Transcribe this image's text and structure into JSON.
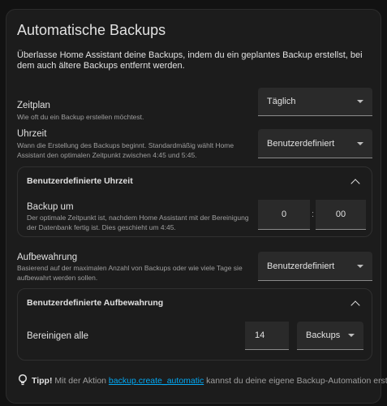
{
  "card": {
    "title": "Automatische Backups",
    "intro": "Überlasse Home Assistant deine Backups, indem du ein geplantes Backup erstellst, bei dem auch ältere Backups entfernt werden."
  },
  "schedule": {
    "title": "Zeitplan",
    "desc": "Wie oft du ein Backup erstellen möchtest.",
    "value": "Täglich",
    "icon": "chevron-down-icon"
  },
  "time": {
    "title": "Uhrzeit",
    "desc": "Wann die Erstellung des Backups beginnt. Standardmäßig wählt Home Assistant den optimalen Zeitpunkt zwischen 4:45 und 5:45.",
    "value": "Benutzerdefiniert"
  },
  "custom_time": {
    "header": "Benutzerdefinierte Uhrzeit",
    "label": "Backup um",
    "desc": "Der optimale Zeitpunkt ist, nachdem Home Assistant mit der Bereinigung der Datenbank fertig ist. Dies geschieht um 4:45.",
    "hours": "0",
    "separator": ":",
    "minutes": "00"
  },
  "retention": {
    "title": "Aufbewahrung",
    "desc": "Basierend auf der maximalen Anzahl von Backups oder wie viele Tage sie aufbewahrt werden sollen.",
    "value": "Benutzerdefiniert"
  },
  "custom_retention": {
    "header": "Benutzerdefinierte Aufbewahrung",
    "label": "Bereinigen alle",
    "count": "14",
    "unit": "Backups"
  },
  "tip": {
    "label": "Tipp!",
    "before": " Mit der Aktion ",
    "link": "backup.create_automatic",
    "after": " kannst du deine eigene Backup-Automation erstellen",
    "icon": "lightbulb-icon"
  },
  "colors": {
    "background": "#121212",
    "card": "#1c1c1c",
    "field": "#2a2a2a",
    "link": "#03a9f4",
    "secondary_text": "#9e9e9e"
  }
}
